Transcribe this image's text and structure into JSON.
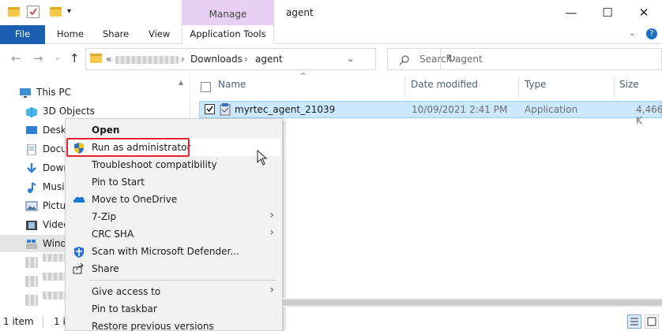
{
  "window": {
    "title": "agent",
    "manage_tab": "Manage",
    "minimize": "—",
    "maximize": "☐",
    "close": "✕",
    "help": "?"
  },
  "ribbon": {
    "file": "File",
    "home": "Home",
    "share": "Share",
    "view": "View",
    "application_tools": "Application Tools"
  },
  "address": {
    "back": "←",
    "forward": "→",
    "recent": "⌄",
    "up": "↑",
    "overflow": "«",
    "sep": "›",
    "crumbs": [
      "Downloads",
      "agent"
    ],
    "refresh": "↻"
  },
  "search": {
    "placeholder": "Search agent"
  },
  "nav": {
    "items": [
      {
        "label": "This PC",
        "icon": "this-pc-icon"
      },
      {
        "label": "3D Objects",
        "icon": "3d-objects-icon"
      },
      {
        "label": "Deskt",
        "icon": "desktop-icon"
      },
      {
        "label": "Docu",
        "icon": "documents-icon"
      },
      {
        "label": "Down",
        "icon": "downloads-icon"
      },
      {
        "label": "Musi",
        "icon": "music-icon"
      },
      {
        "label": "Pictu",
        "icon": "pictures-icon"
      },
      {
        "label": "Video",
        "icon": "videos-icon"
      },
      {
        "label": "Wind",
        "icon": "windows-drive-icon"
      }
    ]
  },
  "columns": {
    "name": "Name",
    "date": "Date modified",
    "type": "Type",
    "size": "Size"
  },
  "files": [
    {
      "name": "myrtec_agent_21039",
      "date": "10/09/2021 2:41 PM",
      "type": "Application",
      "size": "4,466 K"
    }
  ],
  "context_menu": {
    "items": [
      {
        "label": "Open",
        "bold": true
      },
      {
        "label": "Run as administrator",
        "icon": "uac-shield-icon"
      },
      {
        "label": "Troubleshoot compatibility"
      },
      {
        "label": "Pin to Start"
      },
      {
        "label": "Move to OneDrive",
        "icon": "onedrive-icon"
      },
      {
        "label": "7-Zip",
        "submenu": "›"
      },
      {
        "label": "CRC SHA",
        "submenu": "›"
      },
      {
        "label": "Scan with Microsoft Defender...",
        "icon": "defender-icon"
      },
      {
        "label": "Share",
        "icon": "share-icon"
      },
      {
        "label": "Give access to",
        "submenu": "›"
      },
      {
        "label": "Pin to taskbar"
      },
      {
        "label": "Restore previous versions"
      }
    ]
  },
  "status": {
    "count": "1 item",
    "selected": "1 i"
  },
  "colors": {
    "file_tab": "#1b5fb0",
    "manage_tab": "#e8d0f5",
    "selection": "#cce8ff",
    "highlight_box": "#e8232b"
  }
}
